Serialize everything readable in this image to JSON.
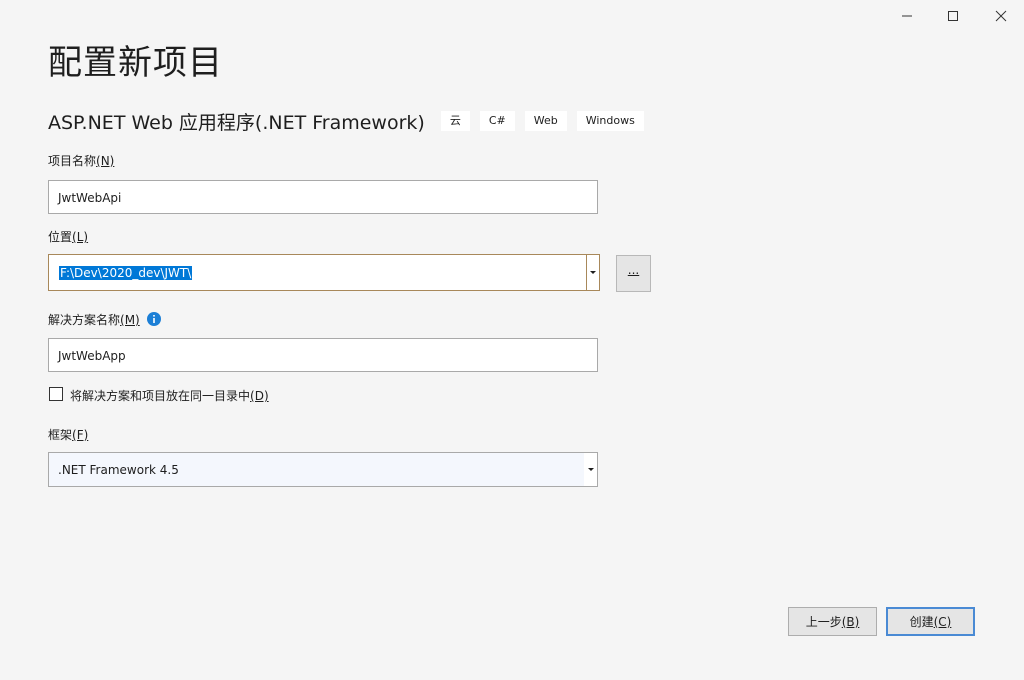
{
  "window": {
    "minimize_icon": "minimize-icon",
    "maximize_icon": "maximize-icon",
    "close_icon": "close-icon"
  },
  "title": "配置新项目",
  "template": {
    "name": "ASP.NET Web 应用程序(.NET Framework)",
    "tags": [
      "云",
      "C#",
      "Web",
      "Windows"
    ]
  },
  "project_name": {
    "label": "项目名称",
    "accel": "(N)",
    "value": "JwtWebApi"
  },
  "location": {
    "label": "位置",
    "accel": "(L)",
    "value": "F:\\Dev\\2020_dev\\JWT\\",
    "browse_label": "..."
  },
  "solution_name": {
    "label": "解决方案名称",
    "accel": "(M)",
    "value": "JwtWebApp",
    "info_icon": "info-icon"
  },
  "same_dir": {
    "label": "将解决方案和项目放在同一目录中",
    "accel": "(D)",
    "checked": false
  },
  "framework": {
    "label": "框架",
    "accel": "(F)",
    "value": ".NET Framework 4.5"
  },
  "buttons": {
    "back_label": "上一步",
    "back_accel": "(B)",
    "create_label": "创建",
    "create_accel": "(C)"
  },
  "colors": {
    "background": "#f5f5f5",
    "selection": "#0078d7",
    "focus_border": "#a8885a",
    "default_button_border": "#4a8ad4",
    "info_icon": "#1c7fd6"
  }
}
